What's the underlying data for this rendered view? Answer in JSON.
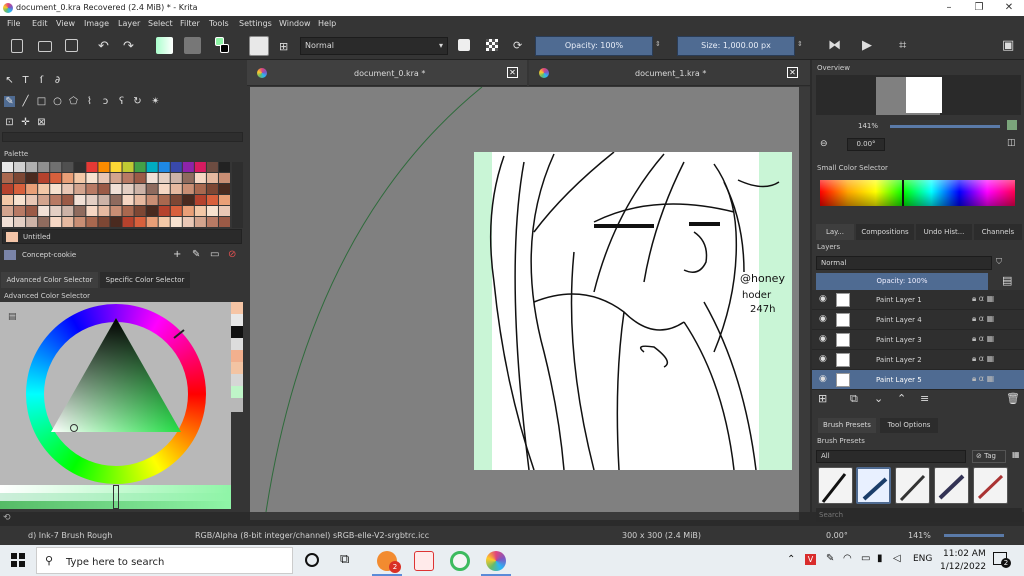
{
  "window": {
    "title": "document_0.kra Recovered  (2.4 MiB)  * - Krita"
  },
  "menu": [
    "File",
    "Edit",
    "View",
    "Image",
    "Layer",
    "Select",
    "Filter",
    "Tools",
    "Settings",
    "Window",
    "Help"
  ],
  "toolbar": {
    "blend_mode": "Normal",
    "opacity": "Opacity: 100%",
    "size": "Size: 1,000.00 px"
  },
  "left": {
    "palette_title": "Palette",
    "palette_name": "Untitled",
    "resource_name": "Concept-cookie",
    "tabs": [
      "Advanced Color Selector",
      "Specific Color Selector"
    ],
    "adv_title": "Advanced Color Selector"
  },
  "docs": {
    "tab1": "document_0.kra *",
    "tab2": "document_1.kra *",
    "close": "✕"
  },
  "artwork": {
    "signature": [
      "@honey",
      "hoder",
      "247h"
    ]
  },
  "right": {
    "overview_title": "Overview",
    "zoom": "141%",
    "rotation": "0.00°",
    "small_color_title": "Small Color Selector",
    "tabs": [
      "Lay...",
      "Compositions",
      "Undo Hist...",
      "Channels"
    ],
    "layers_title": "Layers",
    "layer_blend": "Normal",
    "layer_opacity": "Opacity:  100%",
    "layers": [
      {
        "name": "Paint Layer 1"
      },
      {
        "name": "Paint Layer 4"
      },
      {
        "name": "Paint Layer 3"
      },
      {
        "name": "Paint Layer 2"
      },
      {
        "name": "Paint Layer 5"
      }
    ],
    "preset_tabs": [
      "Brush Presets",
      "Tool Options"
    ],
    "presets_title": "Brush Presets",
    "preset_filter": "All",
    "tag_label": "Tag",
    "search_placeholder": "Search"
  },
  "status": {
    "brush": "d) Ink-7 Brush Rough",
    "color_info": "RGB/Alpha (8-bit integer/channel)  sRGB-elle-V2-srgbtrc.icc",
    "dims": "300 x 300 (2.4 MiB)",
    "rotation": "0.00°",
    "zoom": "141%"
  },
  "taskbar": {
    "search_placeholder": "Type here to search",
    "lang": "ENG",
    "time": "11:02 AM",
    "date": "1/12/2022",
    "notif_count": "2",
    "badge_count": "2"
  }
}
